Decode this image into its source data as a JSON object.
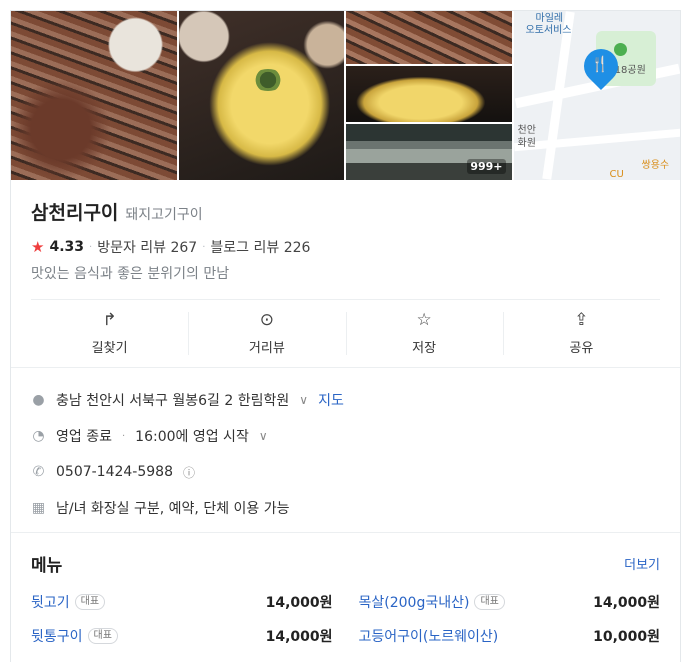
{
  "gallery": {
    "more_count": "999+",
    "map": {
      "labels": [
        "마일레",
        "오토서비스",
        "용18공원",
        "천안",
        "화원",
        "쌍용수",
        "CU"
      ]
    }
  },
  "place": {
    "name": "삼천리구이",
    "category": "돼지고기구이",
    "rating": "4.33",
    "visitor_reviews": "방문자 리뷰 267",
    "blog_reviews": "블로그 리뷰 226",
    "description": "맛있는 음식과 좋은 분위기의 만남"
  },
  "actions": [
    {
      "label": "길찾기",
      "icon": "directions-icon"
    },
    {
      "label": "거리뷰",
      "icon": "street-view-icon"
    },
    {
      "label": "저장",
      "icon": "star-outline-icon"
    },
    {
      "label": "공유",
      "icon": "share-icon"
    }
  ],
  "details": {
    "address": "충남 천안시 서북구 월봉6길 2 한림학원",
    "map_link": "지도",
    "hours_status": "영업 종료",
    "hours_next": "16:00에 영업 시작",
    "phone": "0507-1424-5988",
    "amenities": "남/녀 화장실 구분, 예약, 단체 이용 가능"
  },
  "menu": {
    "title": "메뉴",
    "more": "더보기",
    "badge_label": "대표",
    "items": [
      {
        "name": "뒷고기",
        "price": "14,000원",
        "badge": true
      },
      {
        "name": "목살(200g국내산)",
        "price": "14,000원",
        "badge": true
      },
      {
        "name": "뒷통구이",
        "price": "14,000원",
        "badge": true
      },
      {
        "name": "고등어구이(노르웨이산)",
        "price": "10,000원",
        "badge": false
      }
    ]
  },
  "colors": {
    "accent_link": "#2a64c5",
    "rating_star": "#ef3e3e",
    "map_pin": "#1f8fe5"
  }
}
